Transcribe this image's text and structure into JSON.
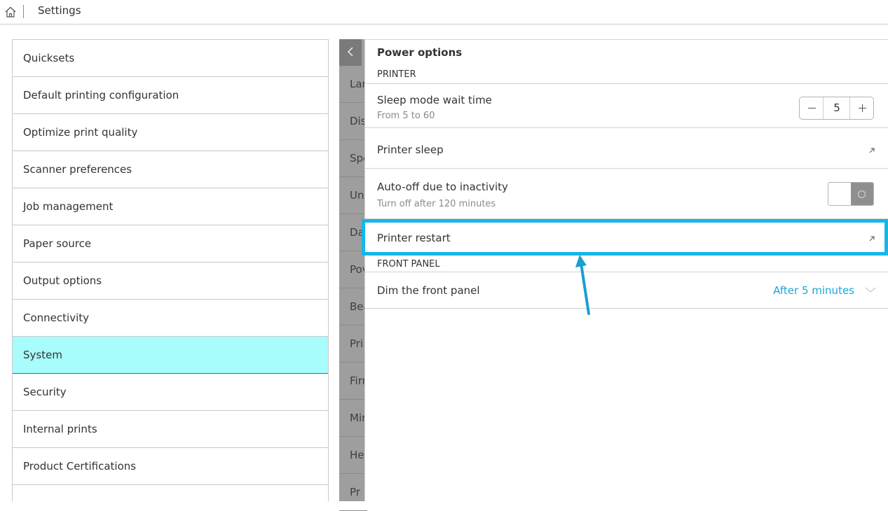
{
  "header": {
    "title": "Settings",
    "home_icon": "home-icon"
  },
  "left_menu": {
    "items": [
      {
        "label": "Quicksets"
      },
      {
        "label": "Default printing configuration"
      },
      {
        "label": "Optimize print quality"
      },
      {
        "label": "Scanner preferences"
      },
      {
        "label": "Job management"
      },
      {
        "label": "Paper source"
      },
      {
        "label": "Output options"
      },
      {
        "label": "Connectivity"
      },
      {
        "label": "System",
        "active": true
      },
      {
        "label": "Security"
      },
      {
        "label": "Internal prints"
      },
      {
        "label": "Product Certifications"
      }
    ]
  },
  "middle_menu": {
    "items": [
      "Lar",
      "Dis",
      "Spe",
      "Uni",
      "Da",
      "Pov",
      "Bea",
      "Pri",
      "Firr",
      "Mir",
      "Hei",
      "Pr"
    ]
  },
  "panel": {
    "title": "Power options",
    "printer_section": "PRINTER",
    "sleep_wait": {
      "label": "Sleep mode wait time",
      "sub": "From 5 to 60",
      "value": "5"
    },
    "printer_sleep": {
      "label": "Printer sleep"
    },
    "auto_off": {
      "label": "Auto-off due to inactivity",
      "sub": "Turn off after 120 minutes",
      "enabled": false
    },
    "printer_restart": {
      "label": "Printer restart"
    },
    "front_panel_section": "FRONT PANEL",
    "dim_front_panel": {
      "label": "Dim the front panel",
      "value": "After 5 minutes"
    }
  },
  "colors": {
    "active_item_bg": "#a8fcfb",
    "highlight": "#15b6ea",
    "link_value": "#1aa7d6"
  }
}
